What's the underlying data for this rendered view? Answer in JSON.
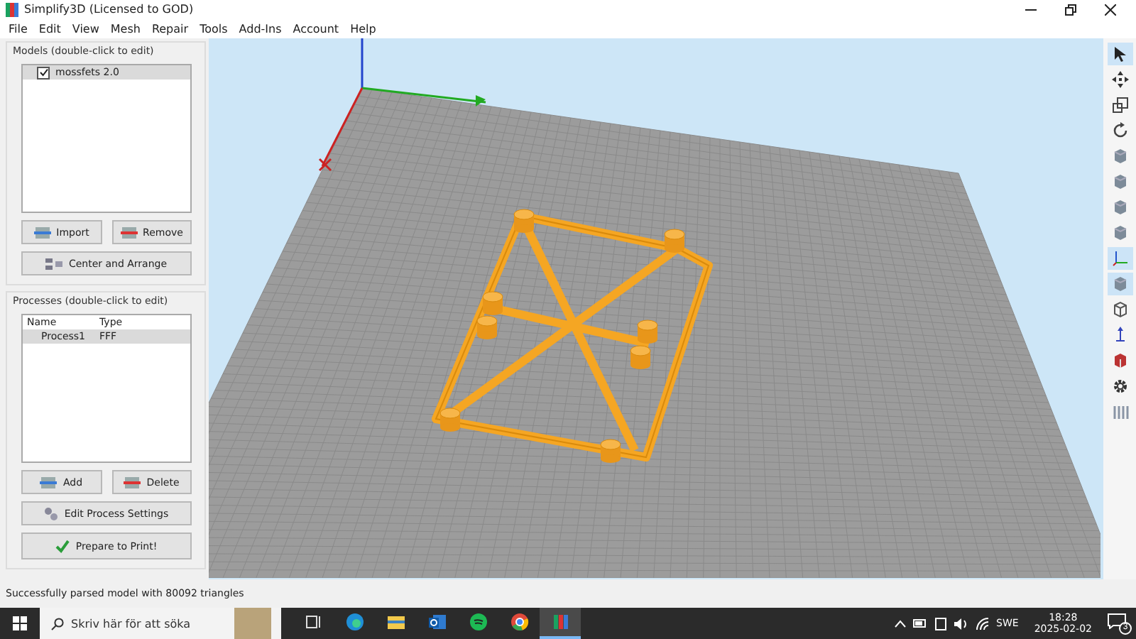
{
  "window": {
    "title": "Simplify3D (Licensed to GOD)"
  },
  "menu": [
    "File",
    "Edit",
    "View",
    "Mesh",
    "Repair",
    "Tools",
    "Add-Ins",
    "Account",
    "Help"
  ],
  "models": {
    "title": "Models (double-click to edit)",
    "items": [
      {
        "label": "mossfets 2.0",
        "checked": true,
        "selected": true
      }
    ],
    "buttons": [
      {
        "label": "Import",
        "kind": "import"
      },
      {
        "label": "Remove",
        "kind": "remove"
      }
    ],
    "arrange": "Center and Arrange"
  },
  "processes": {
    "title": "Processes (double-click to edit)",
    "columns": [
      "Name",
      "Type"
    ],
    "rows": [
      {
        "name": "Process1",
        "type": "FFF",
        "selected": true
      }
    ],
    "buttons": [
      {
        "label": "Add",
        "kind": "add"
      },
      {
        "label": "Delete",
        "kind": "delete"
      }
    ],
    "edit": "Edit Process Settings",
    "prepare": "Prepare to Print!"
  },
  "toolbar": [
    {
      "kind": "pointer",
      "selected": true
    },
    {
      "kind": "move",
      "selected": false
    },
    {
      "kind": "scale",
      "selected": false
    },
    {
      "kind": "rotate",
      "selected": false
    },
    {
      "kind": "cube",
      "selected": false
    },
    {
      "kind": "cube",
      "selected": false
    },
    {
      "kind": "cube",
      "selected": false
    },
    {
      "kind": "cube",
      "selected": false
    },
    {
      "kind": "axes",
      "selected": true
    },
    {
      "kind": "cube",
      "selected": true
    },
    {
      "kind": "box",
      "selected": false
    },
    {
      "kind": "arrow",
      "selected": false
    },
    {
      "kind": "red",
      "selected": false
    },
    {
      "kind": "gear",
      "selected": false
    },
    {
      "kind": "bars",
      "selected": false
    }
  ],
  "status_bar": "Successfully parsed model with 80092 triangles",
  "taskbar": {
    "search_placeholder": "Skriv här för att söka",
    "apps": [
      {
        "kind": "taskview",
        "selected": false
      },
      {
        "kind": "edge",
        "selected": false
      },
      {
        "kind": "folder",
        "selected": false
      },
      {
        "kind": "outlook",
        "selected": false
      },
      {
        "kind": "spotify",
        "selected": false
      },
      {
        "kind": "chrome",
        "selected": false
      },
      {
        "kind": "s3d",
        "selected": true
      }
    ],
    "language": "SWE",
    "time": "18:28",
    "date": "2025-02-02",
    "notifications": "3"
  }
}
